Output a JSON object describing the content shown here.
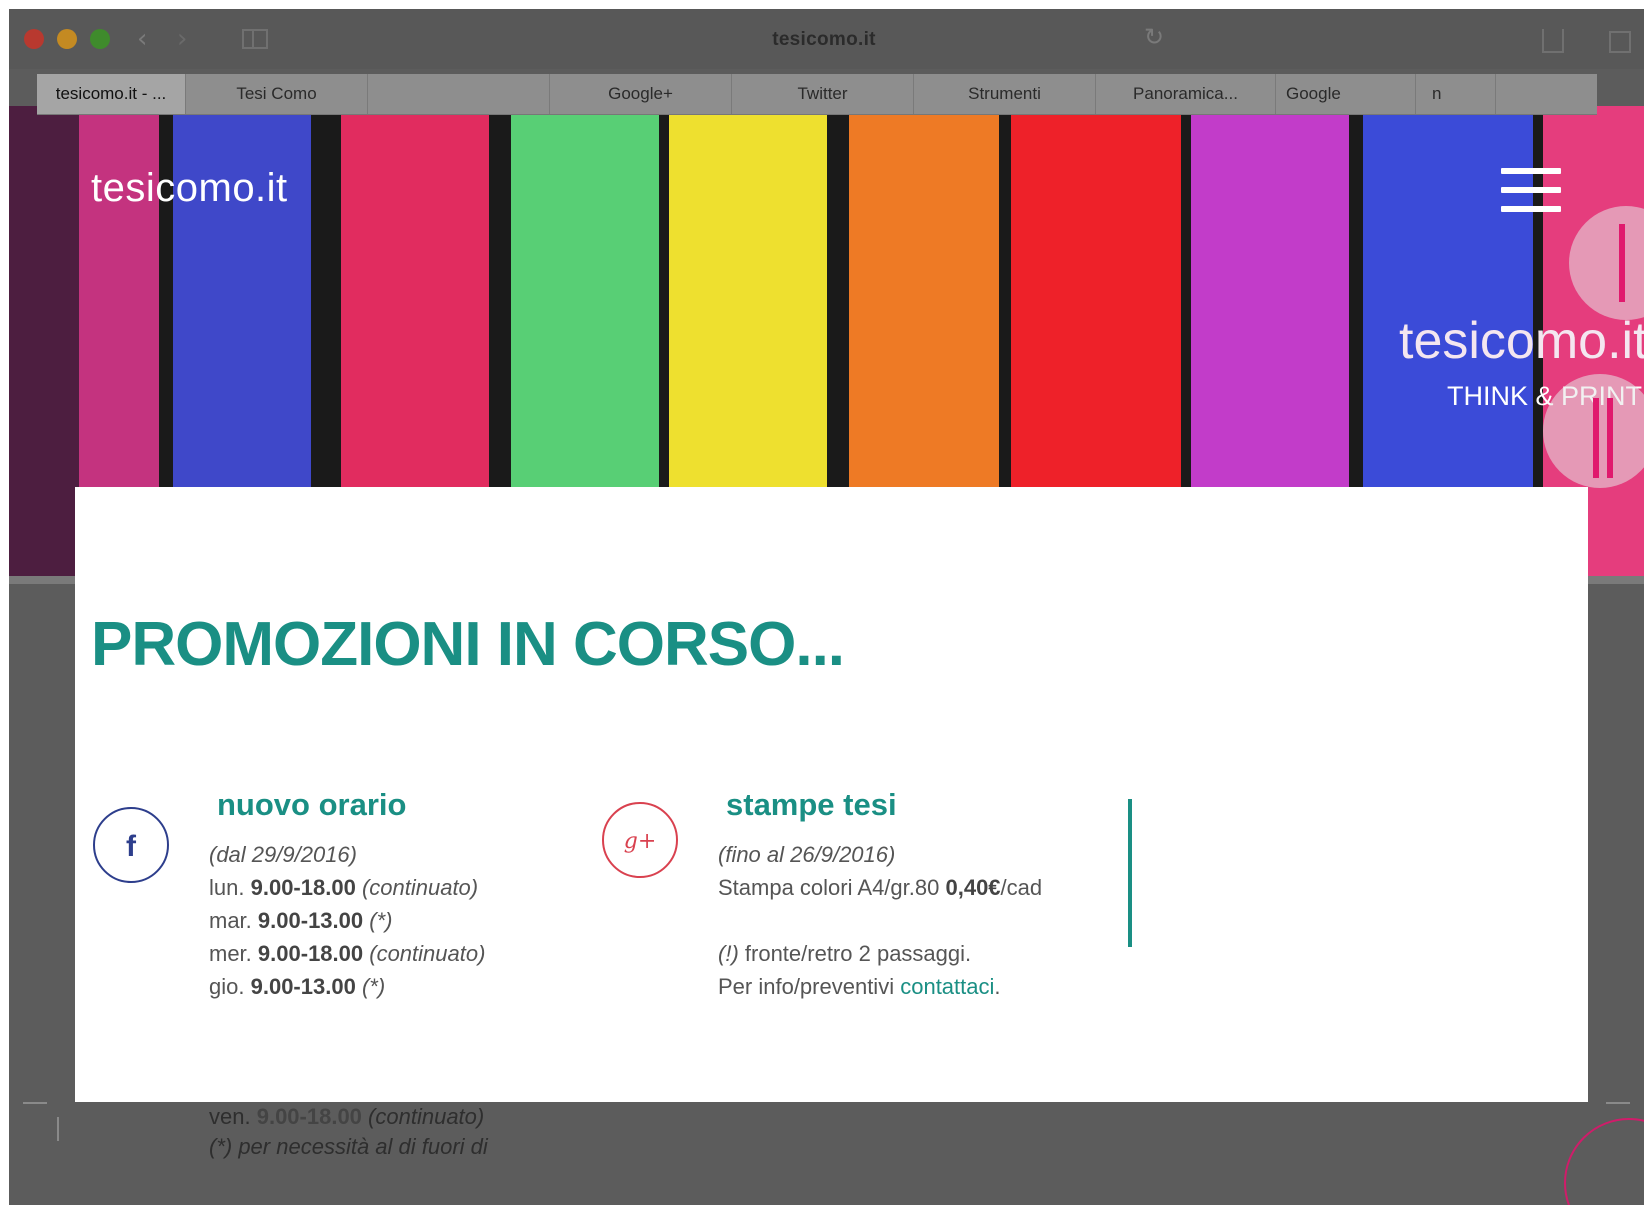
{
  "browser": {
    "url": "tesicomo.it",
    "bookmarks": [
      {
        "label": "tesicomo.it - ...",
        "active": true
      },
      {
        "label": "Tesi Como",
        "active": false
      },
      {
        "label": "",
        "active": false
      },
      {
        "label": "Google+",
        "active": false
      },
      {
        "label": "Twitter",
        "active": false
      },
      {
        "label": "Strumenti",
        "active": false
      },
      {
        "label": "Panoramica...",
        "active": false
      },
      {
        "label": "Google",
        "active": false
      },
      {
        "label": "n",
        "active": false
      }
    ]
  },
  "site": {
    "logo": "tesicomo.it",
    "hero_title": "tesicomo.it",
    "hero_subtitle": "THINK & PRINT"
  },
  "promo": {
    "heading": "PROMOZIONI IN CORSO...",
    "card1": {
      "icon": "facebook-icon",
      "title": "nuovo orario",
      "since": "(dal 29/9/2016)",
      "rows": [
        {
          "day": "lun.",
          "hours": "9.00-18.00",
          "note": "(continuato)"
        },
        {
          "day": "mar.",
          "hours": "9.00-13.00",
          "note": "(*)"
        },
        {
          "day": "mer.",
          "hours": "9.00-18.00",
          "note": "(continuato)"
        },
        {
          "day": "gio.",
          "hours": "9.00-13.00",
          "note": "(*)"
        },
        {
          "day": "ven.",
          "hours": "9.00-18.00",
          "note": "(continuato)"
        }
      ],
      "footnote": "(*) per necessità al di fuori di"
    },
    "card2": {
      "icon": "google-plus-icon",
      "title": "stampe tesi",
      "until": "(fino al 26/9/2016)",
      "line1_text": "Stampa colori A4/gr.80",
      "line1_price": "0,40€",
      "line1_unit": "/cad",
      "note_mark": "(!)",
      "note_text": "fronte/retro 2 passaggi.",
      "info_text": "Per info/preventivi",
      "info_link": "contattaci",
      "info_end": "."
    }
  },
  "colors": {
    "accent": "#1a8f84",
    "facebook": "#2d3e8c",
    "google_plus": "#d9414f",
    "slider": "#e0196d"
  }
}
